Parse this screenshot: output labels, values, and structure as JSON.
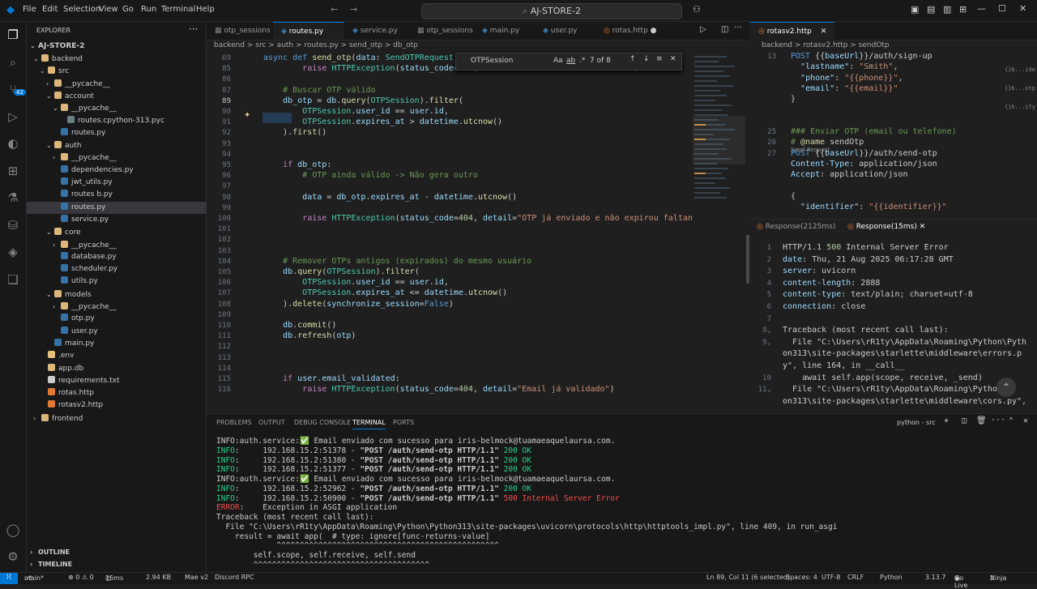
{
  "title": {
    "menu": [
      "File",
      "Edit",
      "Selection",
      "View",
      "Go",
      "Run",
      "Terminal",
      "Help"
    ],
    "search": "AJ-STORE-2"
  },
  "activity": [
    "files-icon",
    "search-icon",
    "source-control-icon",
    "run-debug-icon",
    "remote-icon",
    "extensions-icon",
    "testing-icon",
    "database-icon",
    "layers-icon",
    "bookmark-icon",
    "account-icon",
    "settings-icon"
  ],
  "scm_badge": "42",
  "explorer": {
    "header": "EXPLORER",
    "root": "AJ-STORE-2",
    "items": [
      {
        "label": "backend",
        "indent": 1,
        "type": "folder-open"
      },
      {
        "label": "src",
        "indent": 2,
        "type": "folder-open"
      },
      {
        "label": "__pycache__",
        "indent": 3,
        "type": "folder"
      },
      {
        "label": "account",
        "indent": 3,
        "type": "folder-open"
      },
      {
        "label": "__pycache__",
        "indent": 4,
        "type": "folder-open"
      },
      {
        "label": "routes.cpython-313.pyc",
        "indent": 5,
        "type": "file"
      },
      {
        "label": "routes.py",
        "indent": 4,
        "type": "py"
      },
      {
        "label": "auth",
        "indent": 3,
        "type": "folder-open"
      },
      {
        "label": "__pycache__",
        "indent": 4,
        "type": "folder"
      },
      {
        "label": "dependencies.py",
        "indent": 4,
        "type": "py"
      },
      {
        "label": "jwt_utils.py",
        "indent": 4,
        "type": "py"
      },
      {
        "label": "routes b.py",
        "indent": 4,
        "type": "py"
      },
      {
        "label": "routes.py",
        "indent": 4,
        "type": "py",
        "selected": true
      },
      {
        "label": "service.py",
        "indent": 4,
        "type": "py"
      },
      {
        "label": "core",
        "indent": 3,
        "type": "folder-open"
      },
      {
        "label": "__pycache__",
        "indent": 4,
        "type": "folder"
      },
      {
        "label": "database.py",
        "indent": 4,
        "type": "py"
      },
      {
        "label": "scheduler.py",
        "indent": 4,
        "type": "py"
      },
      {
        "label": "utils.py",
        "indent": 4,
        "type": "py"
      },
      {
        "label": "models",
        "indent": 3,
        "type": "folder-open"
      },
      {
        "label": "__pycache__",
        "indent": 4,
        "type": "folder"
      },
      {
        "label": "otp.py",
        "indent": 4,
        "type": "py"
      },
      {
        "label": "user.py",
        "indent": 4,
        "type": "py"
      },
      {
        "label": "main.py",
        "indent": 3,
        "type": "py"
      },
      {
        "label": ".env",
        "indent": 2,
        "type": "env"
      },
      {
        "label": "app.db",
        "indent": 2,
        "type": "db"
      },
      {
        "label": "requirements.txt",
        "indent": 2,
        "type": "txt"
      },
      {
        "label": "rotas.http",
        "indent": 2,
        "type": "http"
      },
      {
        "label": "rotasv2.http",
        "indent": 2,
        "type": "http"
      },
      {
        "label": "frontend",
        "indent": 1,
        "type": "folder"
      }
    ],
    "outline": "OUTLINE",
    "timeline": "TIMELINE"
  },
  "editor": {
    "tabs": [
      {
        "label": "otp_sessions",
        "active": false
      },
      {
        "label": "routes.py",
        "active": true
      },
      {
        "label": "service.py",
        "active": false
      },
      {
        "label": "otp_sessions",
        "active": false
      },
      {
        "label": "main.py",
        "active": false
      },
      {
        "label": "user.py",
        "active": false
      },
      {
        "label": "rotas.http",
        "active": false
      }
    ],
    "breadcrumb": "backend > src > auth > routes.py > send_otp > db_otp",
    "find": {
      "value": "OTPSession",
      "count": "7 of 8",
      "case": "Aa",
      "word": "ab",
      "regex": ".*"
    },
    "lines": [
      {
        "n": "69",
        "html": "<span class='kw'>async</span> <span class='kw'>def</span> <span class='fn'>send_otp</span>(<span class='var'>data</span>: <span class='cls'>SendOTPRequest</span>, <span class='var'>db</span>:"
      },
      {
        "n": "85",
        "html": "        <span class='ctl'>raise</span> <span class='cls'>HTTPException</span>(<span class='var'>status_code</span>=<span class='num'>404</span>, <span class='var'>detail</span>=<span class='str'>\"Usuário não encontrado\"</span>)"
      },
      {
        "n": "86",
        "html": ""
      },
      {
        "n": "87",
        "html": "    <span class='cm'># Buscar OTP válido</span>"
      },
      {
        "n": "89",
        "html": "    <span class='var'>db_otp</span> = <span class='var'>db</span>.<span class='fn'>query</span>(<span class='cls'>OTPSession</span>).<span class='fn'>filter</span>("
      },
      {
        "n": "90",
        "html": "        <span class='cls'>OTPSession</span>.<span class='var'>user_id</span> == <span class='var'>user</span>.<span class='var'>id</span>,"
      },
      {
        "n": "91",
        "html": "        <span class='cls'>OTPSession</span>.<span class='var'>expires_at</span> &gt; <span class='var'>datetime</span>.<span class='fn'>utcnow</span>()"
      },
      {
        "n": "92",
        "html": "    ).<span class='fn'>first</span>()"
      },
      {
        "n": "93",
        "html": ""
      },
      {
        "n": "94",
        "html": ""
      },
      {
        "n": "95",
        "html": "    <span class='ctl'>if</span> <span class='var'>db_otp</span>:"
      },
      {
        "n": "96",
        "html": "        <span class='cm'># OTP ainda válido -&gt; Não gera outro</span>"
      },
      {
        "n": "97",
        "html": ""
      },
      {
        "n": "98",
        "html": "        <span class='var'>data</span> = <span class='var'>db_otp</span>.<span class='var'>expires_at</span> - <span class='var'>datetime</span>.<span class='fn'>utcnow</span>()"
      },
      {
        "n": "99",
        "html": ""
      },
      {
        "n": "100",
        "html": "        <span class='ctl'>raise</span> <span class='cls'>HTTPException</span>(<span class='var'>status_code</span>=<span class='num'>404</span>, <span class='var'>detail</span>=<span class='str'>\"OTP já enviado e não expirou faltando \"</span>, da"
      },
      {
        "n": "101",
        "html": ""
      },
      {
        "n": "102",
        "html": ""
      },
      {
        "n": "103",
        "html": ""
      },
      {
        "n": "104",
        "html": "    <span class='cm'># Remover OTPs antigos (expirados) do mesmo usuário</span>"
      },
      {
        "n": "105",
        "html": "    <span class='var'>db</span>.<span class='fn'>query</span>(<span class='cls'>OTPSession</span>).<span class='fn'>filter</span>("
      },
      {
        "n": "106",
        "html": "        <span class='cls'>OTPSession</span>.<span class='var'>user_id</span> == <span class='var'>user</span>.<span class='var'>id</span>,"
      },
      {
        "n": "107",
        "html": "        <span class='cls'>OTPSession</span>.<span class='var'>expires_at</span> &lt;= <span class='var'>datetime</span>.<span class='fn'>utcnow</span>()"
      },
      {
        "n": "108",
        "html": "    ).<span class='fn'>delete</span>(<span class='var'>synchronize_session</span>=<span class='kw'>False</span>)"
      },
      {
        "n": "109",
        "html": ""
      },
      {
        "n": "110",
        "html": "    <span class='var'>db</span>.<span class='fn'>commit</span>()"
      },
      {
        "n": "111",
        "html": "    <span class='var'>db</span>.<span class='fn'>refresh</span>(<span class='var'>otp</span>)"
      },
      {
        "n": "112",
        "html": ""
      },
      {
        "n": "113",
        "html": ""
      },
      {
        "n": "114",
        "html": ""
      },
      {
        "n": "115",
        "html": "    <span class='ctl'>if</span> <span class='var'>user</span>.<span class='var'>email_validated</span>:"
      },
      {
        "n": "116",
        "html": "        <span class='ctl'>raise</span> <span class='cls'>HTTPException</span>(<span class='var'>status_code</span>=<span class='num'>404</span>, <span class='var'>detail</span>=<span class='str'>\"Email já validado\"</span>)"
      }
    ]
  },
  "right": {
    "tab": "rotasv2.http",
    "breadcrumb": "backend > rotasv2.http > sendOtp",
    "lines": [
      {
        "n": "13",
        "html": "<span class='kw'>POST</span> {{<span class='var'>baseUrl</span>}}/auth/sign-up"
      },
      {
        "n": "",
        "html": "  <span class='var'>\"lastname\"</span>: <span class='str'>\"Smith\"</span>,"
      },
      {
        "n": "",
        "html": "  <span class='var'>\"phone\"</span>: <span class='str'>\"{{phone}}\"</span>,"
      },
      {
        "n": "",
        "html": "  <span class='var'>\"email\"</span>: <span class='str'>\"{{email}}\"</span>"
      },
      {
        "n": "",
        "html": "}"
      },
      {
        "n": "",
        "html": ""
      },
      {
        "n": "",
        "html": ""
      },
      {
        "n": "25",
        "html": "<span class='cm'>### Enviar OTP (email ou telefone)</span>"
      },
      {
        "n": "26",
        "html": "<span class='cm'># </span><span class='fn'>@name</span> sendOtp"
      },
      {
        "n": "27",
        "html": "<span class='kw'>POST</span> {{<span class='var'>baseUrl</span>}}/auth/send-otp"
      },
      {
        "n": "",
        "html": "<span class='var'>Content-Type</span>: application/json"
      },
      {
        "n": "",
        "html": "<span class='var'>Accept</span>: application/json"
      },
      {
        "n": "",
        "html": ""
      },
      {
        "n": "",
        "html": "{"
      },
      {
        "n": "",
        "html": "  <span class='var'>\"identifier\"</span>: <span class='str'>\"{{identifier}}\"</span>"
      }
    ],
    "codelens": "Send Request",
    "resp_tabs": [
      "Response(2125ms)",
      "Response(15ms)"
    ],
    "resp_lines": [
      {
        "n": "1",
        "html": "HTTP/1.1 <span class='num'>500</span> Internal Server Error"
      },
      {
        "n": "2",
        "html": "<span class='var'>date</span>: Thu, 21 Aug 2025 06:17:28 GMT"
      },
      {
        "n": "3",
        "html": "<span class='var'>server</span>: uvicorn"
      },
      {
        "n": "4",
        "html": "<span class='var'>content-length</span>: 2888"
      },
      {
        "n": "5",
        "html": "<span class='var'>content-type</span>: text/plain; charset=utf-8"
      },
      {
        "n": "6",
        "html": "<span class='var'>connection</span>: close"
      },
      {
        "n": "7",
        "html": ""
      },
      {
        "n": "8",
        "html": "Traceback (most recent call last):"
      },
      {
        "n": "9",
        "html": "  File \"C:\\Users\\rR1ty\\AppData\\Roaming\\Python\\Pyth"
      },
      {
        "n": "",
        "html": "on313\\site-packages\\starlette\\middleware\\errors.p"
      },
      {
        "n": "",
        "html": "y\", line 164, in __call__"
      },
      {
        "n": "10",
        "html": "    await self.app(scope, receive, _send)"
      },
      {
        "n": "11",
        "html": "  File \"C:\\Users\\rR1ty\\AppData\\Roaming\\Python\\P"
      },
      {
        "n": "",
        "html": "on313\\site-packages\\starlette\\middleware\\cors.py\","
      }
    ],
    "side_hints": [
      "{}b...ide",
      "{}b...otp",
      "{}b...ify"
    ]
  },
  "panel": {
    "tabs": [
      "PROBLEMS",
      "OUTPUT",
      "DEBUG CONSOLE",
      "TERMINAL",
      "PORTS"
    ],
    "active": "TERMINAL",
    "shell": "python - src",
    "lines": [
      "<span>INFO:auth.service:</span><span class='ok'>✅</span> Email enviado com sucesso para iris-belmock@tuamaeaquelaursa.com.",
      "<span class='ok'>INFO</span>:     192.168.15.2:51378 - <b>\"POST /auth/send-otp HTTP/1.1\"</b> <span class='ok'>200 OK</span>",
      "<span class='ok'>INFO</span>:     192.168.15.2:51380 - <b>\"POST /auth/send-otp HTTP/1.1\"</b> <span class='ok'>200 OK</span>",
      "<span class='ok'>INFO</span>:     192.168.15.2:51377 - <b>\"POST /auth/send-otp HTTP/1.1\"</b> <span class='ok'>200 OK</span>",
      "<span>INFO:auth.service:</span><span class='ok'>✅</span> Email enviado com sucesso para iris-belmock@tuamaeaquelaursa.com.",
      "<span class='ok'>INFO</span>:     192.168.15.2:52962 - <b>\"POST /auth/send-otp HTTP/1.1\"</b> <span class='ok'>200 OK</span>",
      "<span class='ok'>INFO</span>:     192.168.15.2:50900 - <b>\"POST /auth/send-otp HTTP/1.1\"</b> <span class='err'>500 Internal Server Error</span>",
      "<span class='err'>ERROR</span>:    Exception in ASGI application",
      "Traceback (most recent call last):",
      "  File \"C:\\Users\\rR1ty\\AppData\\Roaming\\Python\\Python313\\site-packages\\uvicorn\\protocols\\http\\httptools_impl.py\", line 409, in run_asgi",
      "    result = await app(  # type: ignore[func-returns-value]",
      "             ^^^^^^^^^^^^^^^^^^^^^^^^^^^^^^^^^^^^^^^^^^^^^^^^",
      "        self.scope, self.receive, self.send",
      "        ^^^^^^^^^^^^^^^^^^^^^^^^^^^^^^^^^^^^^^"
    ]
  },
  "status": {
    "branch": "main*",
    "problems": "⊗ 0 ⚠ 0",
    "time": "15ms",
    "size": "2.94 KB",
    "mae": "Mae v2",
    "discord": "Discord RPC",
    "pos": "Ln 89, Col 11 (6 selected)",
    "spaces": "Spaces: 4",
    "enc": "UTF-8",
    "eol": "CRLF",
    "lang": "Python",
    "ver": "3.13.7",
    "golive": "Go Live",
    "ninja": "Ninja"
  },
  "colors": {
    "accent": "#0078d4",
    "folder": "#dcb67a",
    "python": "#3572a5",
    "http": "#e37933"
  }
}
